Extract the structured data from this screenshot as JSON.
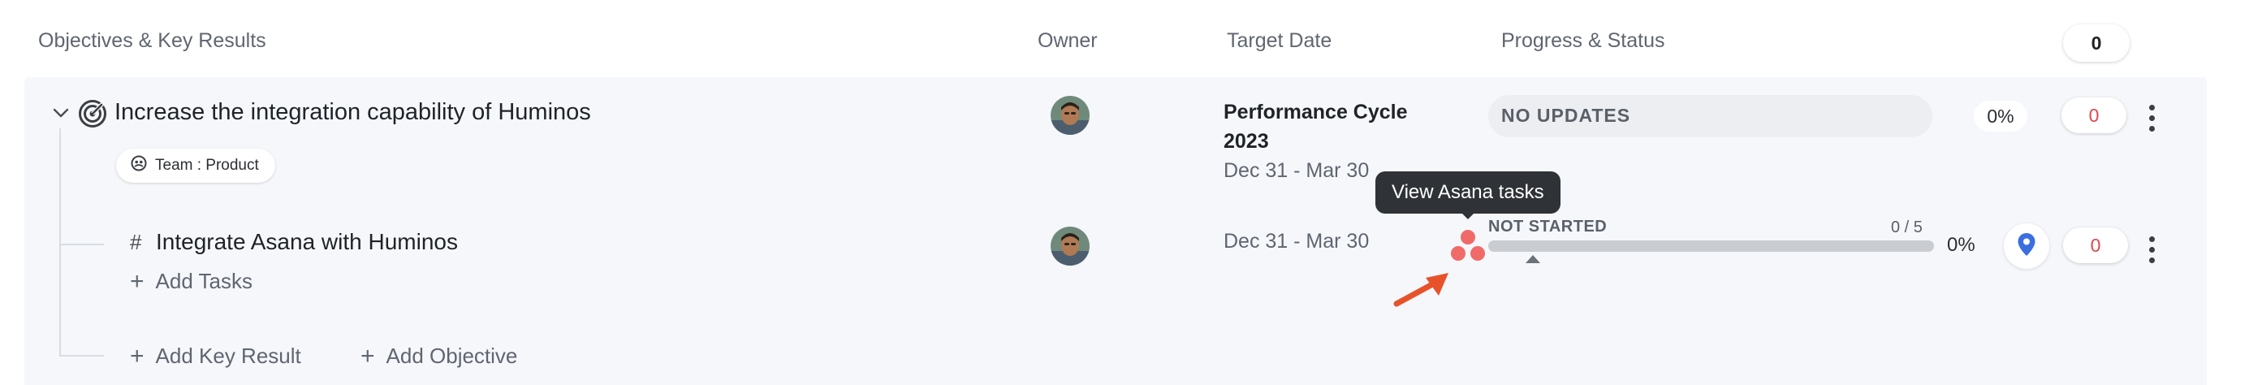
{
  "header": {
    "col_objectives": "Objectives & Key Results",
    "col_owner": "Owner",
    "col_target_date": "Target Date",
    "col_progress_status": "Progress & Status",
    "count": "0"
  },
  "objective": {
    "title": "Increase the integration capability of Huminos",
    "team_tag": "Team : Product",
    "cycle_line1": "Performance Cycle",
    "cycle_line2": "2023",
    "date_range": "Dec 31 - Mar 30",
    "status": "NO UPDATES",
    "progress": "0%",
    "progress_value": 0,
    "comment_count": "0"
  },
  "key_result": {
    "title": "Integrate Asana with Huminos",
    "date_range": "Dec 31 - Mar 30",
    "status": "NOT STARTED",
    "task_count": "0 / 5",
    "progress": "0%",
    "progress_value": 0,
    "comment_count": "0",
    "add_tasks_label": "Add Tasks"
  },
  "tooltip": {
    "text": "View Asana tasks"
  },
  "footer": {
    "add_key_result": "Add Key Result",
    "add_objective": "Add Objective"
  },
  "colors": {
    "accent_red": "#e0474c",
    "asana_coral": "#f06a6a",
    "annotation_arrow": "#e8522b",
    "pin_blue": "#3b6fe0"
  },
  "icons": {
    "expand": "chevron-down-icon",
    "objective": "target-icon",
    "team": "team-icon",
    "key_result": "hash-icon",
    "asana": "asana-logo-icon",
    "pin": "location-pin-icon",
    "more": "kebab-icon"
  }
}
